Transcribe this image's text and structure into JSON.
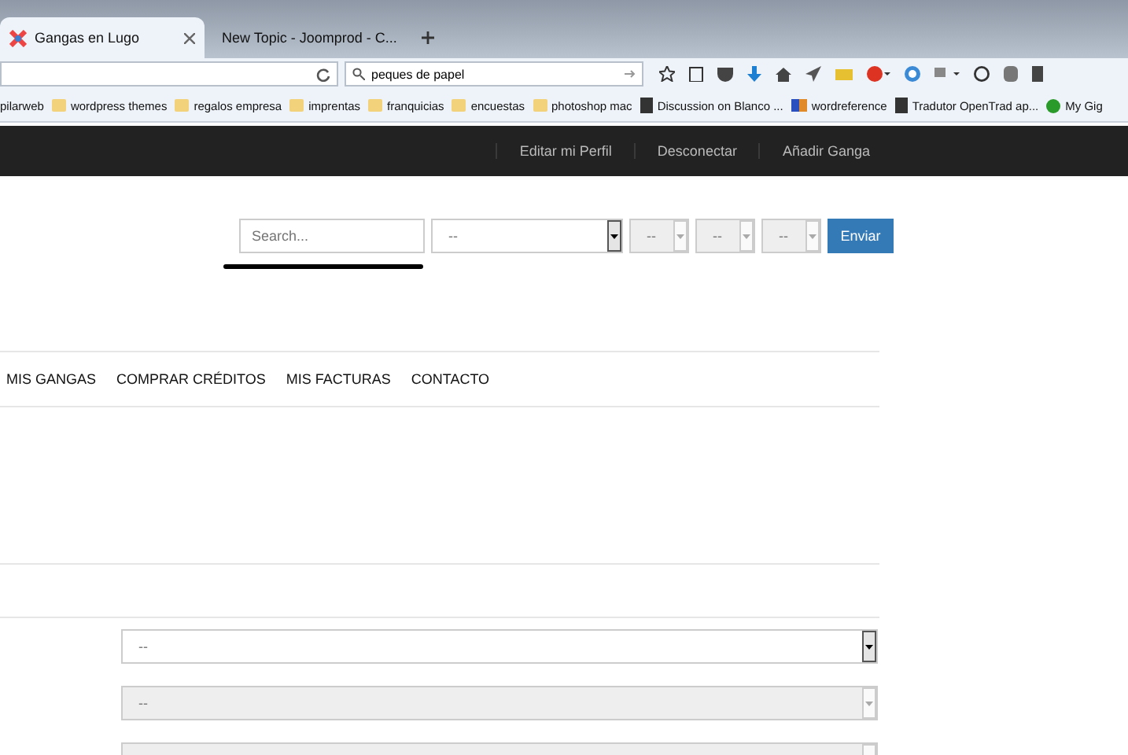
{
  "browser": {
    "tabs": [
      {
        "title": "Gangas en Lugo",
        "selected": true
      },
      {
        "title": "New Topic - Joomprod - C...",
        "selected": false
      }
    ],
    "search_query": "peques de papel",
    "bookmarks": [
      {
        "label": "pilarweb",
        "kind": "plain"
      },
      {
        "label": "wordpress themes",
        "kind": "folder"
      },
      {
        "label": "regalos empresa",
        "kind": "folder"
      },
      {
        "label": "imprentas",
        "kind": "folder"
      },
      {
        "label": "franquicias",
        "kind": "folder"
      },
      {
        "label": "encuestas",
        "kind": "folder"
      },
      {
        "label": "photoshop mac",
        "kind": "folder"
      },
      {
        "label": "Discussion on Blanco ...",
        "kind": "page"
      },
      {
        "label": "wordreference",
        "kind": "wr"
      },
      {
        "label": "Tradutor OpenTrad ap...",
        "kind": "page"
      },
      {
        "label": "My Gig",
        "kind": "green"
      }
    ]
  },
  "top_nav": [
    "Editar mi Perfil",
    "Desconectar",
    "Añadir Ganga"
  ],
  "search_form": {
    "placeholder": "Search...",
    "selects": [
      {
        "value": "--",
        "disabled": false
      },
      {
        "value": "--",
        "disabled": true
      },
      {
        "value": "--",
        "disabled": true
      },
      {
        "value": "--",
        "disabled": true
      }
    ],
    "button": "Enviar"
  },
  "main_menu": [
    "MIS GANGAS",
    "COMPRAR CRÉDITOS",
    "MIS FACTURAS",
    "CONTACTO"
  ],
  "form_selects": [
    {
      "value": "--",
      "disabled": false
    },
    {
      "value": "--",
      "disabled": true
    },
    {
      "disabled": true
    }
  ]
}
